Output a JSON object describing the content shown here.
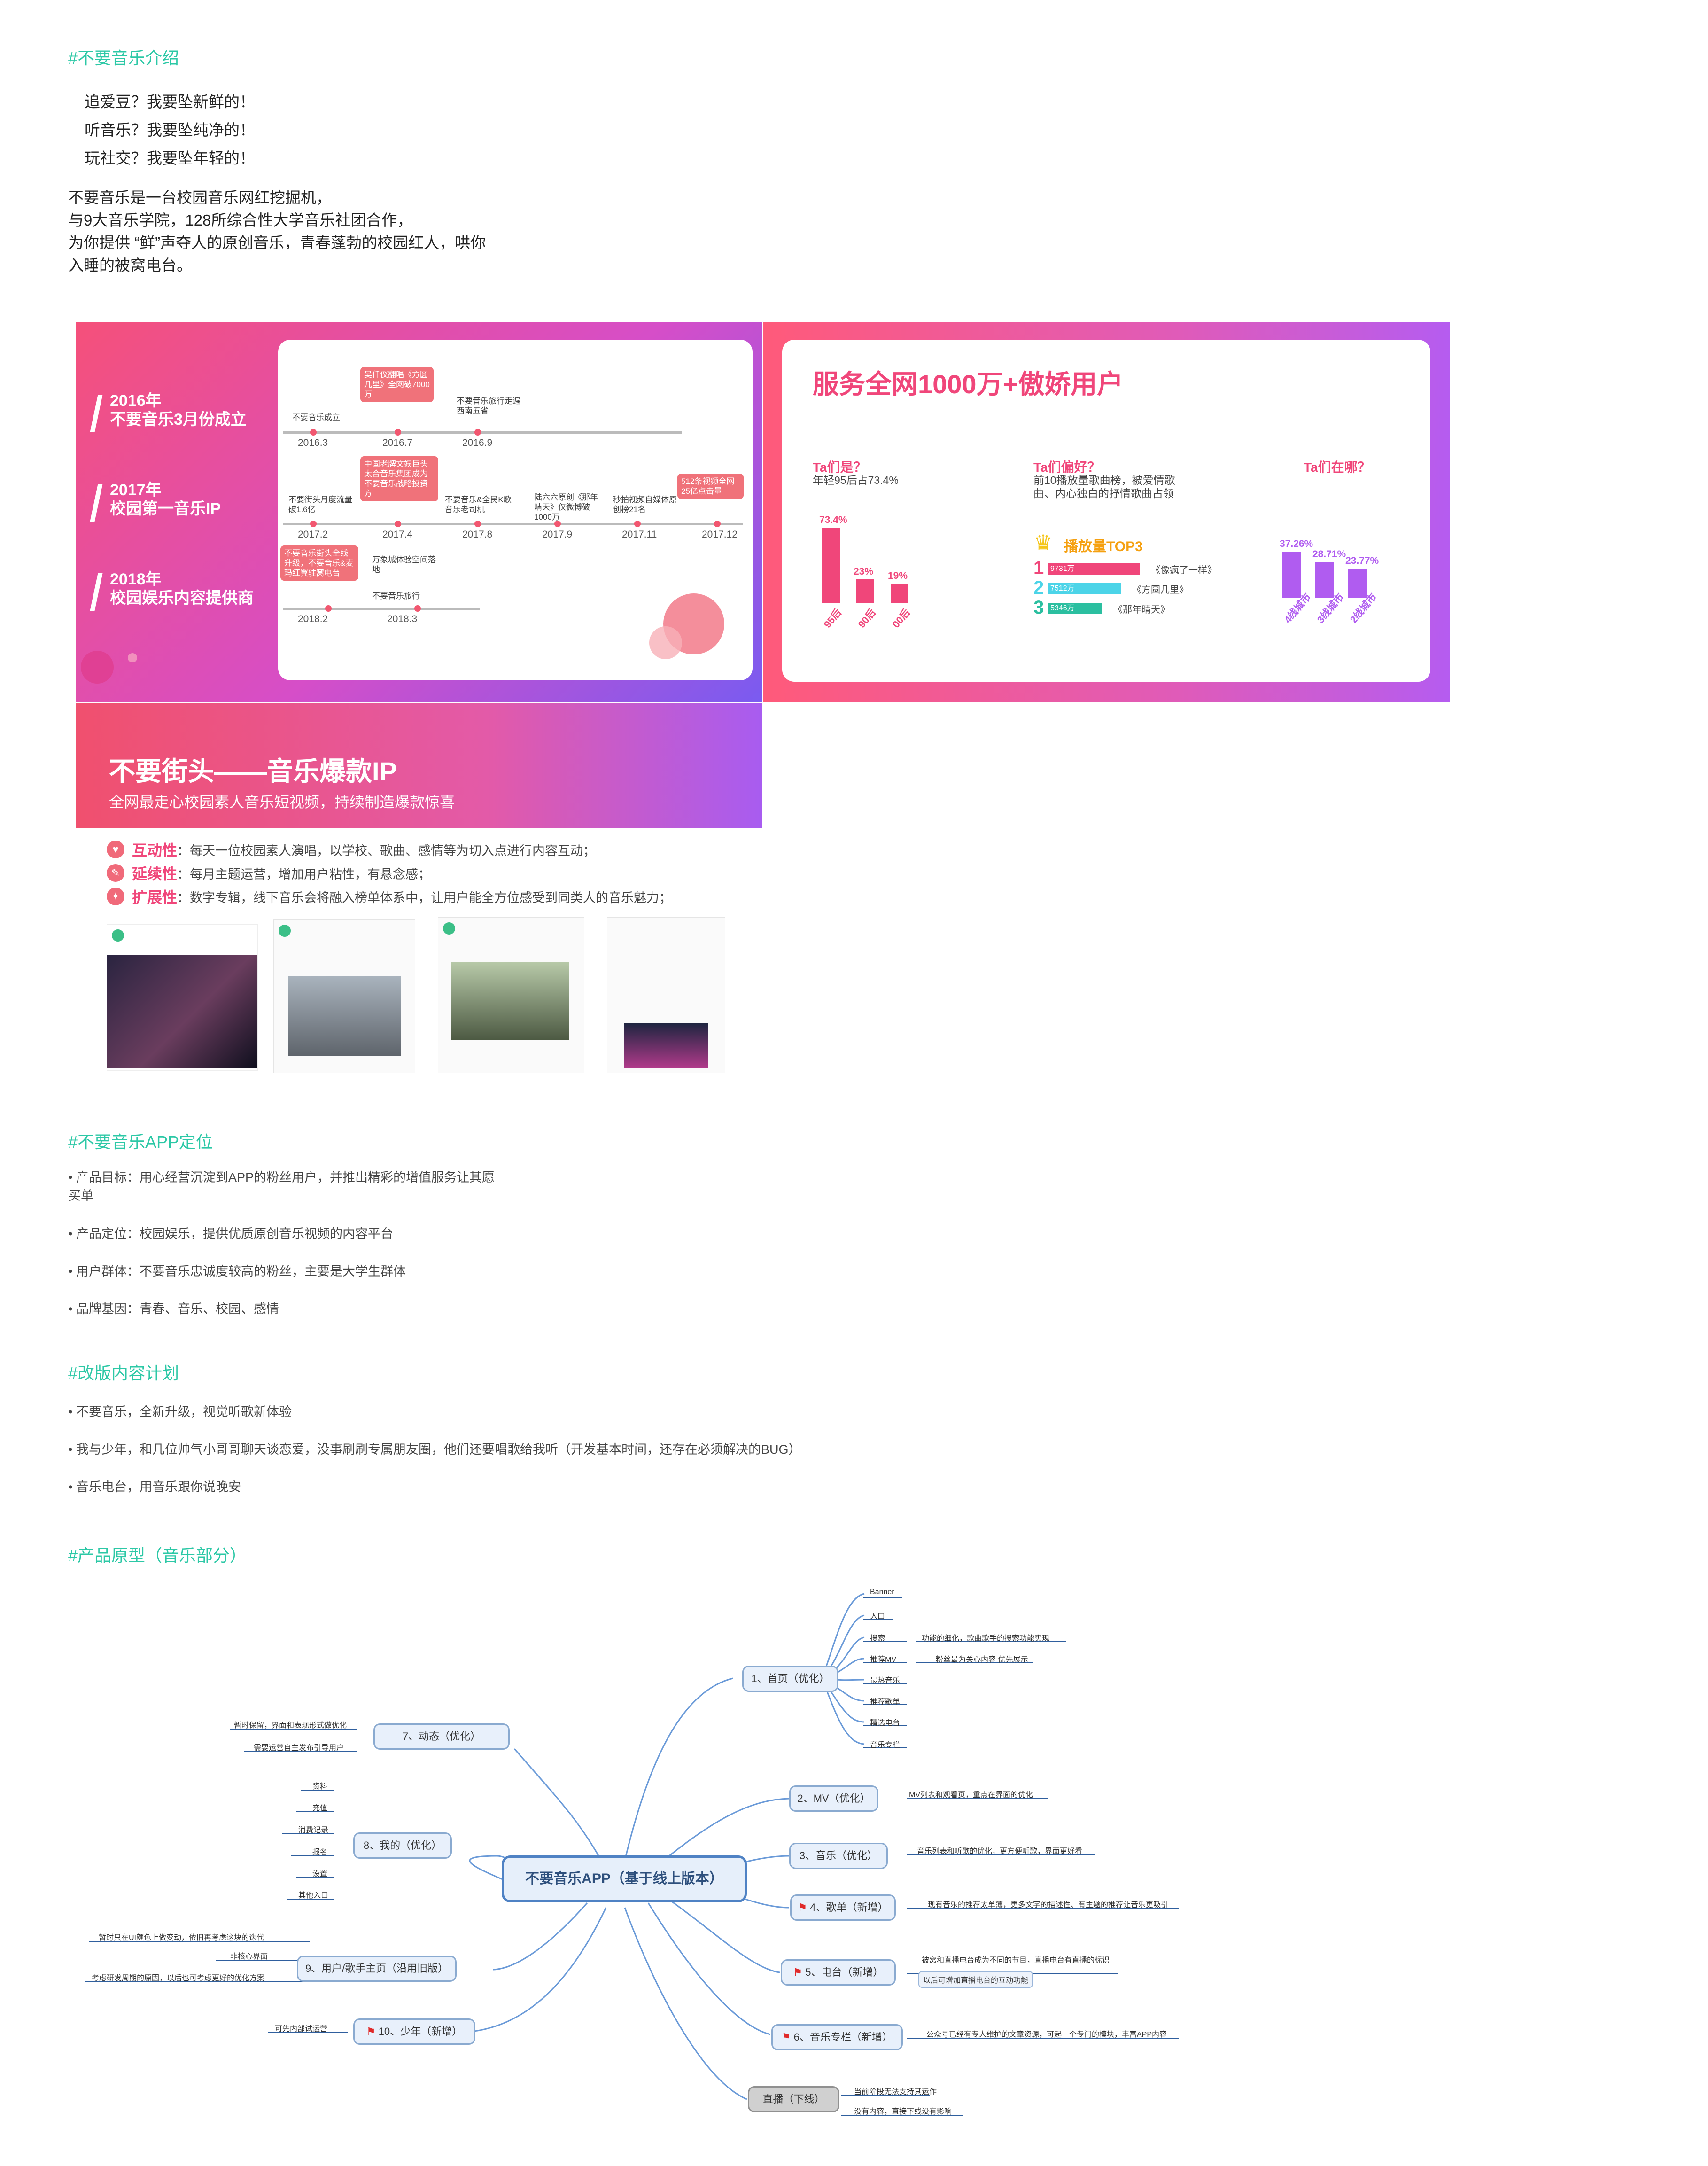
{
  "intro": {
    "heading": "#不要音乐介绍",
    "slogans": [
      "追爱豆？我要坠新鲜的！",
      "听音乐？我要坠纯净的！",
      "玩社交？我要坠年轻的！"
    ],
    "description": [
      "不要音乐是一台校园音乐网红挖掘机，",
      "与9大音乐学院，128所综合性大学音乐社团合作，",
      "为你提供 “鲜”声夺人的原创音乐，青春蓬勃的校园红人，哄你",
      "入睡的被窝电台。"
    ]
  },
  "slide_timeline": {
    "years": [
      {
        "year": "2016年",
        "text": "不要音乐3月份成立"
      },
      {
        "year": "2017年",
        "text": "校园第一音乐IP"
      },
      {
        "year": "2018年",
        "text": "校园娱乐内容提供商"
      }
    ],
    "row1": {
      "dates": [
        "2016.3",
        "2016.7",
        "2016.9"
      ],
      "events": [
        "不要音乐成立",
        "吴仟仪翻唱《方圆几里》全网破7000万",
        "不要音乐旅行走遍西南五省"
      ]
    },
    "row2": {
      "dates": [
        "2017.2",
        "2017.4",
        "2017.8",
        "2017.9",
        "2017.11",
        "2017.12"
      ],
      "events": [
        "不要街头月度流量破1.6亿",
        "中国老牌文娱巨头太合音乐集团成为不要音乐战略投资方",
        "不要音乐&全民K歌音乐老司机",
        "陆六六原创《那年晴天》仅微博破1000万",
        "秒拍视频自媒体原创榜21名",
        "512条视频全网25亿点击量"
      ]
    },
    "row3": {
      "dates": [
        "2018.2",
        "2018.3"
      ],
      "events": [
        "不要音乐街头全线升级，不要音乐&麦玛红翼驻窝电台",
        "万象城体验空间落地",
        "不要音乐旅行"
      ]
    }
  },
  "slide_users": {
    "title": "服务全网1000万+傲娇用户",
    "who": {
      "q": "Ta们是？",
      "desc": "年轻95后占73.4%"
    },
    "prefer": {
      "q": "Ta们偏好？",
      "desc": "前10播放量歌曲榜，被爱情歌曲、内心独白的抒情歌曲占领",
      "top3_title": "播放量TOP3"
    },
    "where": {
      "q": "Ta们在哪？"
    },
    "top3": [
      {
        "rank": "1",
        "plays": "9731万",
        "song": "《像疯了一样》",
        "color": "#f0467a"
      },
      {
        "rank": "2",
        "plays": "7512万",
        "song": "《方圆几里》",
        "color": "#4cd4e8"
      },
      {
        "rank": "3",
        "plays": "5346万",
        "song": "《那年晴天》",
        "color": "#2bbfa0"
      }
    ]
  },
  "chart_data": [
    {
      "type": "bar",
      "categories": [
        "95后",
        "90后",
        "00后"
      ],
      "values": [
        73.4,
        23,
        19
      ],
      "labels": [
        "73.4%",
        "23%",
        "19%"
      ],
      "color": "#f0467a"
    },
    {
      "type": "bar",
      "categories": [
        "4线城市",
        "3线城市",
        "2线城市"
      ],
      "values": [
        37.26,
        28.71,
        23.77
      ],
      "labels": [
        "37.26%",
        "28.71%",
        "23.77%"
      ],
      "color": "#b05cf0"
    }
  ],
  "slide_ip": {
    "title": "不要街头——音乐爆款IP",
    "subtitle": "全网最走心校园素人音乐短视频，持续制造爆款惊喜",
    "features": [
      {
        "name": "互动性",
        "text": "：每天一位校园素人演唱，以学校、歌曲、感情等为切入点进行内容互动；"
      },
      {
        "name": "延续性",
        "text": "：每月主题运营，增加用户粘性，有悬念感；"
      },
      {
        "name": "扩展性",
        "text": "：数字专辑，线下音乐会将融入榜单体系中，让用户能全方位感受到同类人的音乐魅力；"
      }
    ]
  },
  "positioning": {
    "heading": "#不要音乐APP定位",
    "items": [
      "• 产品目标：用心经营沉淀到APP的粉丝用户，并推出精彩的增值服务让其愿",
      "买单",
      "• 产品定位：校园娱乐，提供优质原创音乐视频的内容平台",
      "• 用户群体：不要音乐忠诚度较高的粉丝，主要是大学生群体",
      "• 品牌基因：青春、音乐、校园、感情"
    ]
  },
  "plan": {
    "heading": "#改版内容计划",
    "items": [
      "• 不要音乐，全新升级，视觉听歌新体验",
      "• 我与少年，和几位帅气小哥哥聊天谈恋爱，没事刷刷专属朋友圈，他们还要唱歌给我听（开发基本时间，还存在必须解决的BUG）",
      "• 音乐电台，用音乐跟你说晚安"
    ]
  },
  "prototype": {
    "heading": "#产品原型（音乐部分）",
    "root": "不要音乐APP（基于线上版本）",
    "nodes": {
      "n1": "1、首页（优化）",
      "n2": "2、MV（优化）",
      "n3": "3、音乐（优化）",
      "n4": "4、歌单（新增）",
      "n5": "5、电台（新增）",
      "n6": "6、音乐专栏（新增）",
      "n7": "7、动态（优化）",
      "n8": "8、我的（优化）",
      "n9": "9、用户/歌手主页（沿用旧版）",
      "n10": "10、少年（新增）",
      "n11": "直播（下线）"
    },
    "leaves": {
      "home": [
        "Banner",
        "入口",
        "搜索",
        "推荐MV",
        "最热音乐",
        "推荐歌单",
        "精选电台",
        "音乐专栏"
      ],
      "search_note": "功能的细化，歌曲歌手的搜索功能实现",
      "mv_note": "粉丝最为关心内容 优先展示",
      "n2_note": "MV列表和观看页，重点在界面的优化",
      "n3_note": "音乐列表和听歌的优化，更方便听歌，界面更好看",
      "n4_note": "现有音乐的推荐太单薄，更多文字的描述性、有主题的推荐让音乐更吸引",
      "n5_notes": [
        "被窝和直播电台成为不同的节目，直播电台有直播的标识",
        "以后可增加直播电台的互动功能"
      ],
      "n6_note": "公众号已经有专人维护的文章资源，可起一个专门的模块，丰富APP内容",
      "n7_notes": [
        "暂时保留，界面和表现形式做优化",
        "需要运营自主发布引导用户"
      ],
      "n8_items": [
        "资料",
        "充值",
        "消费记录",
        "报名",
        "设置",
        "其他入口"
      ],
      "n9_notes": [
        "暂时只在UI颜色上做变动，依旧再考虑这块的迭代",
        "非核心界面",
        "考虑研发周期的原因，以后也可考虑更好的优化方案"
      ],
      "n10_note": "可先内部试运营",
      "n11_notes": [
        "当前阶段无法支持其运作",
        "没有内容，直接下线没有影响"
      ]
    }
  }
}
